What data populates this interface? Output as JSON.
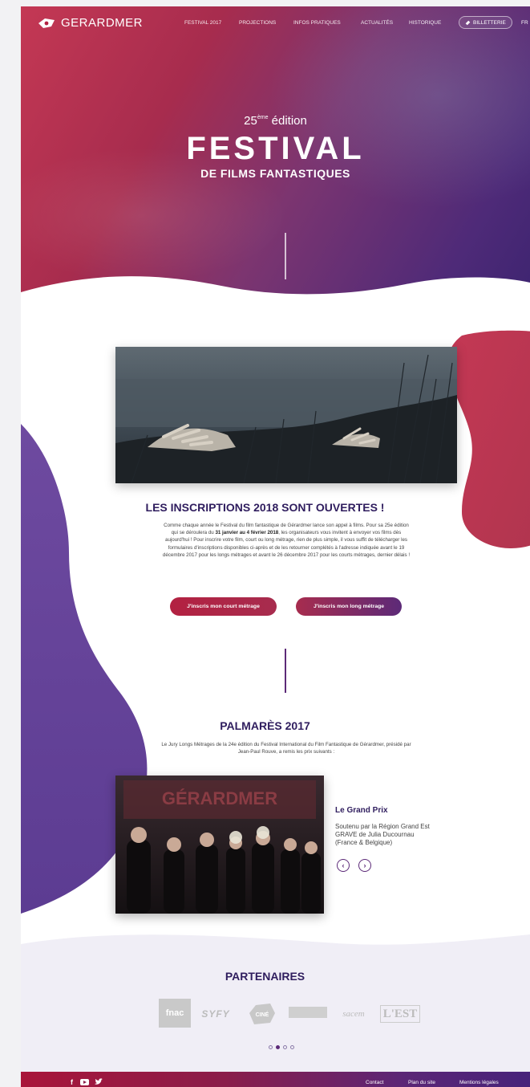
{
  "header": {
    "logo_text": "GERARDMER",
    "nav": [
      "FESTIVAL 2017",
      "PROJECTIONS",
      "INFOS PRATIQUES",
      "ACTUALITÉS",
      "HISTORIQUE"
    ],
    "ticket_label": "BILLETTERIE",
    "lang": "FR"
  },
  "hero": {
    "edition_number": "25",
    "edition_suffix": "ème",
    "edition_word": "édition",
    "title": "FESTIVAL",
    "subtitle": "DE FILMS FANTASTIQUES"
  },
  "inscriptions": {
    "title": "LES INSCRIPTIONS 2018 SONT OUVERTES !",
    "text_1": "Comme chaque année le Festival du film fantastique de Gérardmer lance son appel à films. Pour sa 25e édition qui se déroulera du ",
    "text_bold": "31 janvier au 4 février 2018",
    "text_2": ", les organisateurs vous invitent à envoyer vos films dès aujourd'hui ! Pour inscrire votre film, court ou long métrage, rien de plus simple, il vous suffit de télécharger les formulaires d'inscriptions disponibles ci-après et de les retourner complétés à l'adresse indiquée avant le 19 décembre 2017 pour les longs métrages et avant le 26 décembre 2017 pour les courts métrages, dernier délais !",
    "button_court": "J'inscris mon court métrage",
    "button_long": "J'inscris mon long métrage"
  },
  "palmares": {
    "title": "PALMARÈS 2017",
    "text": "Le Jury Longs Métrages de la 24e édition du Festival International du Film Fantastique de Gérardmer, présidé par Jean-Paul Rouve, a remis les prix suivants :",
    "photo_banner": "GÉRARDMER",
    "award_name": "Le Grand Prix",
    "award_line1": "Soutenu par la Région Grand Est",
    "award_line2": "GRAVE de Julia Ducournau",
    "award_line3": "(France & Belgique)"
  },
  "partners": {
    "title": "PARTENAIRES",
    "logos": [
      "fnac",
      "SYFY",
      "CINÉ",
      "sacem",
      "L'EST"
    ]
  },
  "footer": {
    "links": [
      "Contact",
      "Plan du site",
      "Mentions légales"
    ]
  },
  "colors": {
    "brand_dark": "#2f1d5e",
    "red": "#b32141",
    "purple": "#5c2a78"
  }
}
